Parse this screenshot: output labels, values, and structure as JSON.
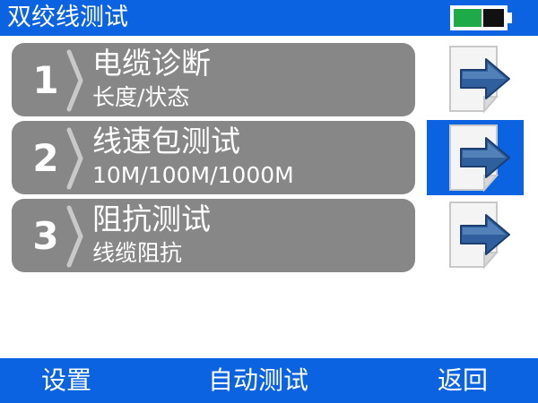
{
  "header": {
    "title": "双绞线测试",
    "battery_level": 0.55
  },
  "menu_items": [
    {
      "number": "1",
      "title": "电缆诊断",
      "subtitle": "长度/状态",
      "selected": false
    },
    {
      "number": "2",
      "title": "线速包测试",
      "subtitle": "10M/100M/1000M",
      "selected": true
    },
    {
      "number": "3",
      "title": "阻抗测试",
      "subtitle": "线缆阻抗",
      "selected": false
    }
  ],
  "footer": {
    "settings_label": "设置",
    "auto_test_label": "自动测试",
    "back_label": "返回"
  },
  "colors": {
    "bar_blue": "#0b63e2",
    "item_gray": "#878787",
    "battery_green": "#1faa48"
  },
  "icons": {
    "item_bracket": "right-bracket-icon",
    "go": "doc-arrow-icon"
  }
}
